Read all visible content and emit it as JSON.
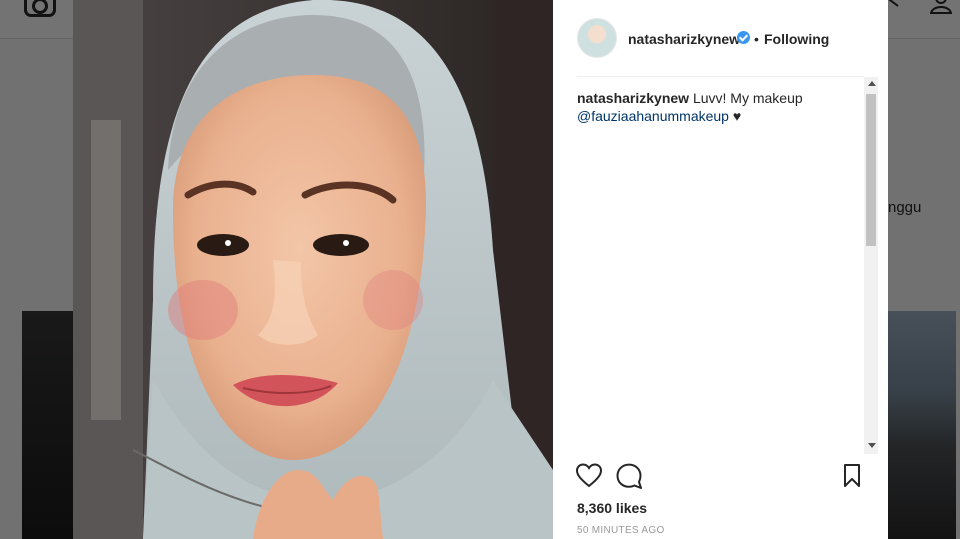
{
  "background": {
    "partial_text": "nggu"
  },
  "post": {
    "username": "natasharizkynew",
    "verified": true,
    "separator": "•",
    "follow_status": "Following",
    "caption": {
      "username": "natasharizkynew",
      "text": "Luvv! My makeup",
      "mention": "@fauziaahanummakeup",
      "emoji": "♥"
    },
    "likes": "8,360 likes",
    "timestamp": "50 minutes ago"
  },
  "colors": {
    "link": "#003569",
    "verified_badge": "#3897f0",
    "text": "#262626",
    "muted": "#999999"
  },
  "icons": {
    "like": "heart-icon",
    "comment": "comment-icon",
    "save": "bookmark-icon",
    "verified": "verified-badge-icon"
  }
}
